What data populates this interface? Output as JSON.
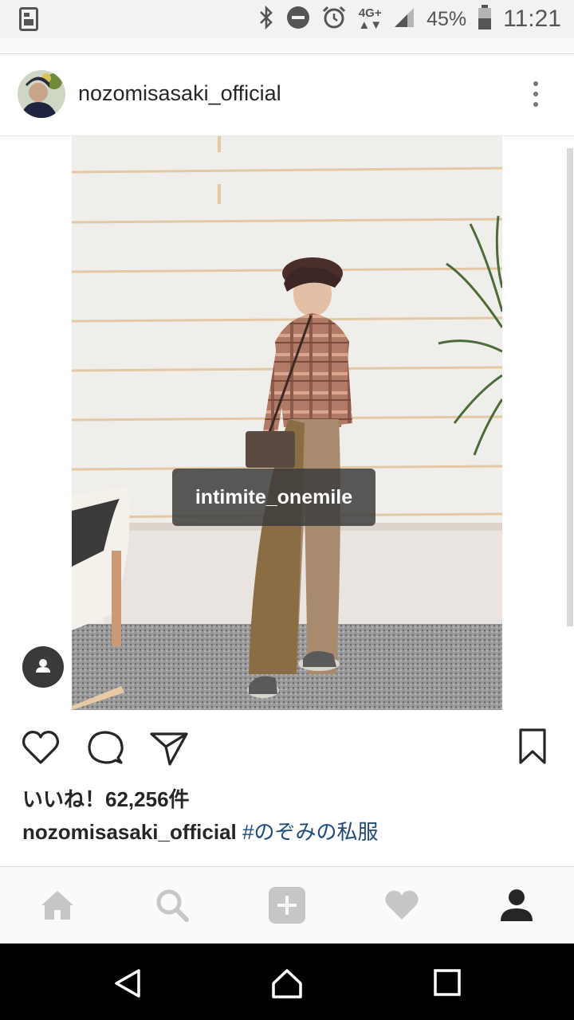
{
  "status": {
    "network": "4G+",
    "battery": "45%",
    "time": "11:21"
  },
  "post": {
    "username": "nozomisasaki_official",
    "tag_label": "intimite_onemile",
    "likes": "いいね！62,256件",
    "caption_user": "nozomisasaki_official",
    "caption_tag": "#のぞみの私服"
  },
  "icons": {
    "status": [
      "sim-icon",
      "bluetooth-icon",
      "dnd-icon",
      "alarm-icon",
      "signal-icon",
      "battery-icon"
    ],
    "actions": [
      "heart-icon",
      "comment-icon",
      "share-icon",
      "bookmark-icon"
    ],
    "tabs": [
      "home-icon",
      "search-icon",
      "add-icon",
      "activity-heart-icon",
      "profile-icon"
    ],
    "nav": [
      "back-icon",
      "home-nav-icon",
      "recents-icon"
    ]
  }
}
